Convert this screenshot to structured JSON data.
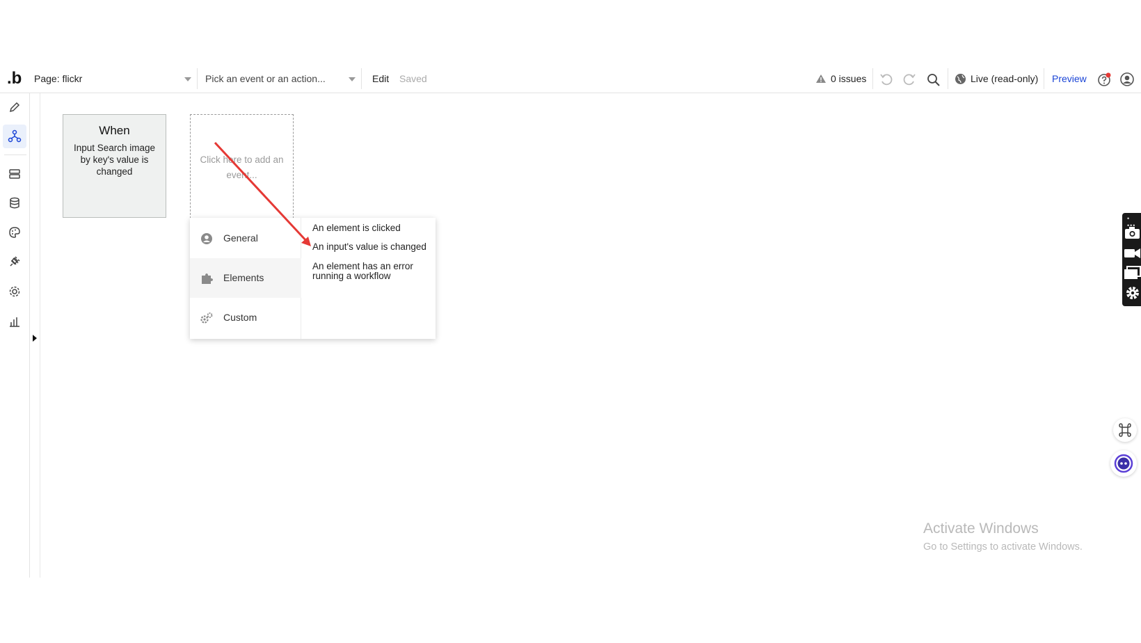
{
  "toolbar": {
    "logo": ".b",
    "page_label": "Page: flickr",
    "event_placeholder": "Pick an event or an action...",
    "edit": "Edit",
    "saved": "Saved",
    "issues": "0 issues",
    "live": "Live (read-only)",
    "preview": "Preview"
  },
  "workflow": {
    "when_title": "When",
    "when_desc": "Input Search image by key's value is changed",
    "add_event": "Click here to add an event..."
  },
  "dropdown": {
    "categories": [
      {
        "label": "General",
        "icon": "user-circle-icon"
      },
      {
        "label": "Elements",
        "icon": "puzzle-icon"
      },
      {
        "label": "Custom",
        "icon": "gears-icon"
      }
    ],
    "options": [
      "An element is clicked",
      "An input's value is changed",
      "An element has an error running a workflow"
    ]
  },
  "watermark": {
    "title": "Activate Windows",
    "subtitle": "Go to Settings to activate Windows."
  },
  "colors": {
    "accent": "#1a44d6",
    "arrow": "#e53935",
    "card_bg": "#eff1f0"
  }
}
